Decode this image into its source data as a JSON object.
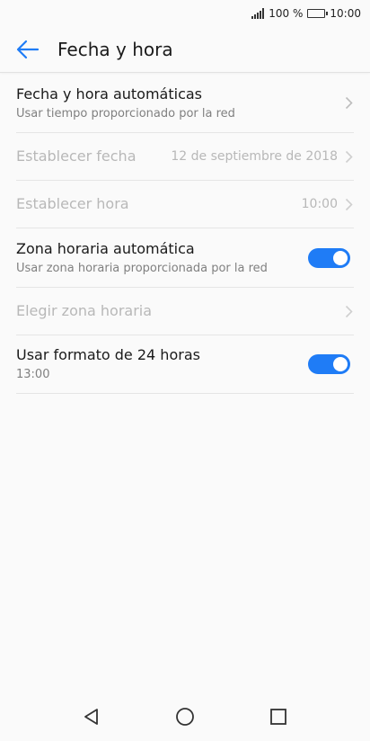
{
  "status_bar": {
    "battery_percent": "100 %",
    "time": "10:00"
  },
  "app_bar": {
    "title": "Fecha y hora"
  },
  "settings": {
    "auto_datetime": {
      "title": "Fecha y hora automáticas",
      "subtitle": "Usar tiempo proporcionado por la red"
    },
    "set_date": {
      "title": "Establecer fecha",
      "value": "12 de septiembre de 2018"
    },
    "set_time": {
      "title": "Establecer hora",
      "value": "10:00"
    },
    "auto_timezone": {
      "title": "Zona horaria automática",
      "subtitle": "Usar zona horaria proporcionada por la red",
      "enabled": true
    },
    "choose_timezone": {
      "title": "Elegir zona horaria"
    },
    "format_24h": {
      "title": "Usar formato de 24 horas",
      "subtitle": "13:00",
      "enabled": true
    }
  },
  "colors": {
    "accent": "#1f7cf6",
    "disabled_text": "#b8b8b8"
  }
}
